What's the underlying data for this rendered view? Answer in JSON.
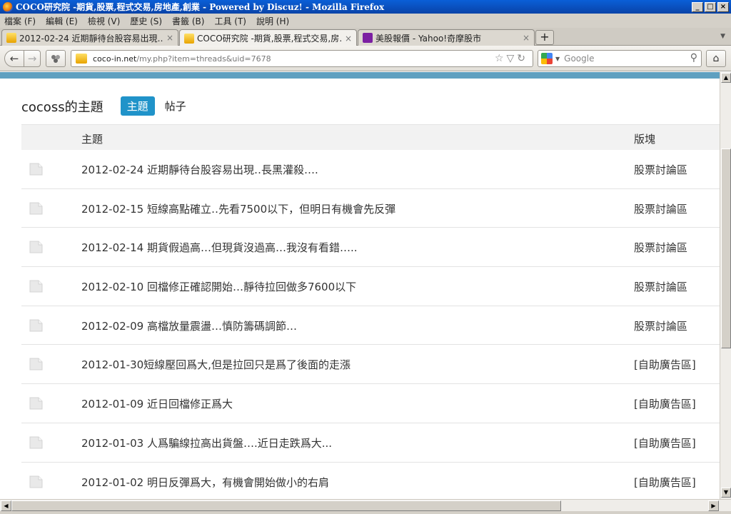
{
  "window": {
    "title": "COCO研究院 -期貨,股票,程式交易,房地產,創業 - Powered by Discuz! - Mozilla Firefox",
    "min": "_",
    "max": "□",
    "close": "×"
  },
  "menu": [
    "檔案 (F)",
    "編輯 (E)",
    "檢視 (V)",
    "歷史 (S)",
    "書籤 (B)",
    "工具 (T)",
    "說明 (H)"
  ],
  "tabs": [
    {
      "label": "2012-02-24 近期靜待台股容易出現…",
      "close": "×"
    },
    {
      "label": "COCO研究院 -期貨,股票,程式交易,房…",
      "close": "×"
    },
    {
      "label": "美股報價 - Yahoo!奇摩股市",
      "close": "×"
    }
  ],
  "new_tab": "+",
  "nav": {
    "back": "←",
    "forward": "→",
    "url_host": "coco-in.net",
    "url_path": "/my.php?item=threads&uid=7678",
    "url_tools": "☆▽↻",
    "search_placeholder": "Google",
    "home": "⌂"
  },
  "page": {
    "title": "cocoss的主題",
    "tab_threads": "主題",
    "tab_posts": "帖子",
    "col_subject": "主題",
    "col_forum": "版塊"
  },
  "threads": [
    {
      "title": "2012-02-24 近期靜待台股容易出現‥長黑灌殺….",
      "forum": "股票討論區"
    },
    {
      "title": "2012-02-15 短線高點確立‥先看7500以下，但明日有機會先反彈",
      "forum": "股票討論區"
    },
    {
      "title": "2012-02-14 期貨假過高…但現貨沒過高…我沒有看錯…..",
      "forum": "股票討論區"
    },
    {
      "title": "2012-02-10 回檔修正確認開始…靜待拉回做多7600以下",
      "forum": "股票討論區"
    },
    {
      "title": "2012-02-09 高檔放量震盪…慎防籌碼調節…",
      "forum": "股票討論區"
    },
    {
      "title": "2012-01-30短線壓回爲大,但是拉回只是爲了後面的走漲",
      "forum": "[自助廣告區]"
    },
    {
      "title": "2012-01-09 近日回檔修正爲大",
      "forum": "[自助廣告區]"
    },
    {
      "title": "2012-01-03 人爲騙線拉高出貨盤….近日走跌爲大...",
      "forum": "[自助廣告區]"
    },
    {
      "title": "2012-01-02 明日反彈爲大，有機會開始做小的右肩",
      "forum": "[自助廣告區]"
    }
  ],
  "scroll": {
    "up": "▲",
    "down": "▼",
    "left": "◀",
    "right": "▶"
  }
}
